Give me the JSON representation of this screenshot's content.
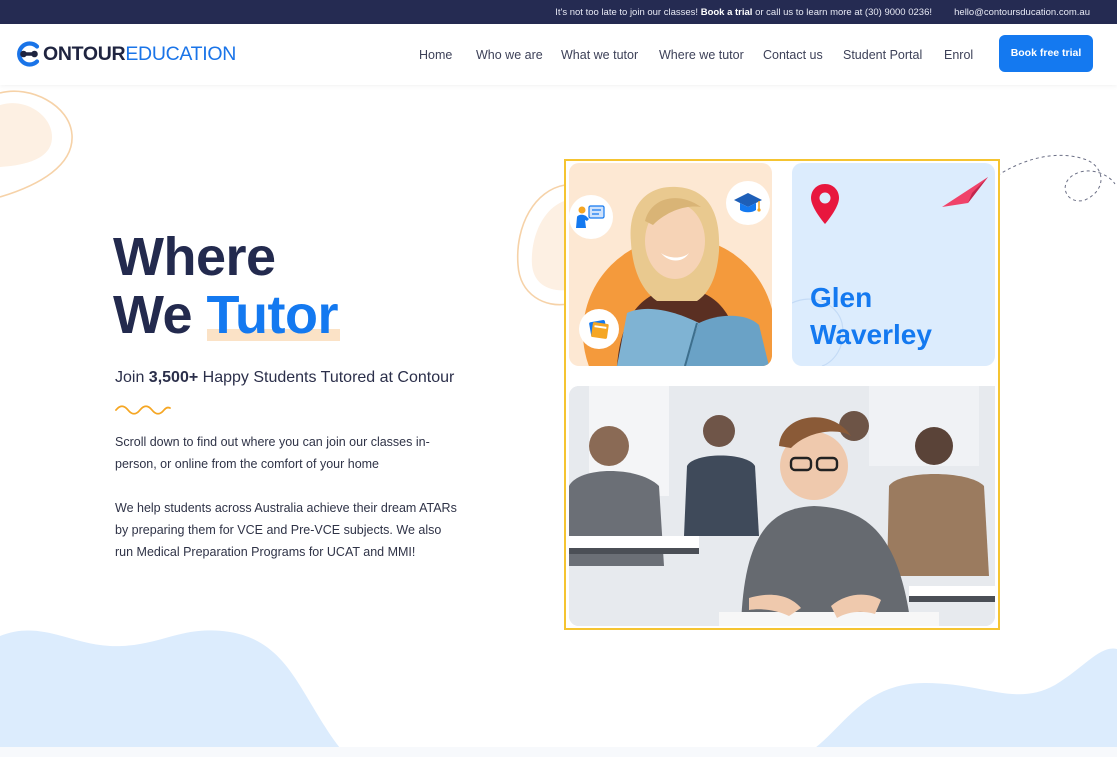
{
  "topbar": {
    "message_pre": "It's not too late to join our classes! ",
    "message_bold": "Book a trial",
    "message_post": " or call us to learn more at (30) 9000 0236!",
    "email": "hello@contoursducation.com.au"
  },
  "header": {
    "logo_part1": "ONTOUR",
    "logo_part2": "EDUCATION",
    "nav": [
      "Home",
      "Who we are",
      "What we tutor",
      "Where we tutor",
      "Contact us",
      "Student Portal",
      "Enrol"
    ],
    "cta_label": "Book free trial"
  },
  "hero": {
    "title_line1": "Where",
    "title_line2_a": "We ",
    "title_line2_b": "Tutor",
    "subtitle_pre": "Join ",
    "subtitle_bold": "3,500+",
    "subtitle_post": " Happy Students Tutored at Contour",
    "paragraph1": "Scroll down to find out where you can join our classes in-person, or online from the comfort of your home",
    "paragraph2": "We help students across Australia achieve their dream ATARs by preparing them for VCE and Pre-VCE subjects. We also run Medical Preparation Programs for UCAT and MMI!"
  },
  "collage": {
    "location_line1": "Glen",
    "location_line2": "Waverley"
  },
  "colors": {
    "navy": "#252b52",
    "brand_blue": "#1479f0",
    "highlight_yellow": "#f5c431",
    "peach": "#fde8d3",
    "light_blue": "#dcecfd",
    "pin_red": "#e8173e"
  },
  "icons": [
    "teacher-board-icon",
    "graduation-cap-icon",
    "book-stack-icon",
    "location-pin-icon",
    "paper-plane-icon",
    "wave-squiggle-icon"
  ]
}
